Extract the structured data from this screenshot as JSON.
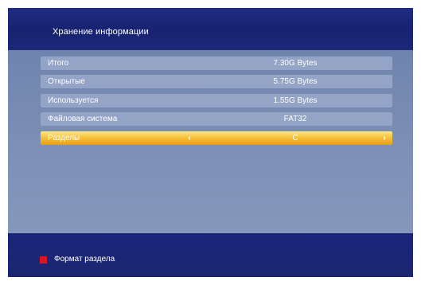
{
  "header": {
    "title": "Хранение информации"
  },
  "rows": [
    {
      "label": "Итого",
      "value": "7.30G Bytes"
    },
    {
      "label": "Открытые",
      "value": "5.75G Bytes"
    },
    {
      "label": "Используется",
      "value": "1.55G Bytes"
    },
    {
      "label": "Файловая система",
      "value": "FAT32"
    },
    {
      "label": "Разделы",
      "value": "C",
      "left_arrow": "‹",
      "right_arrow": "›"
    }
  ],
  "footer": {
    "red_key_icon": "red-square-icon",
    "red_key_color": "#e0141c",
    "red_label": "Формат раздела"
  },
  "colors": {
    "header_bg": "#1f2c82",
    "content_bg": "#7e90b4",
    "row_bg": "#94a4c6",
    "highlight": "#f6c23d"
  }
}
